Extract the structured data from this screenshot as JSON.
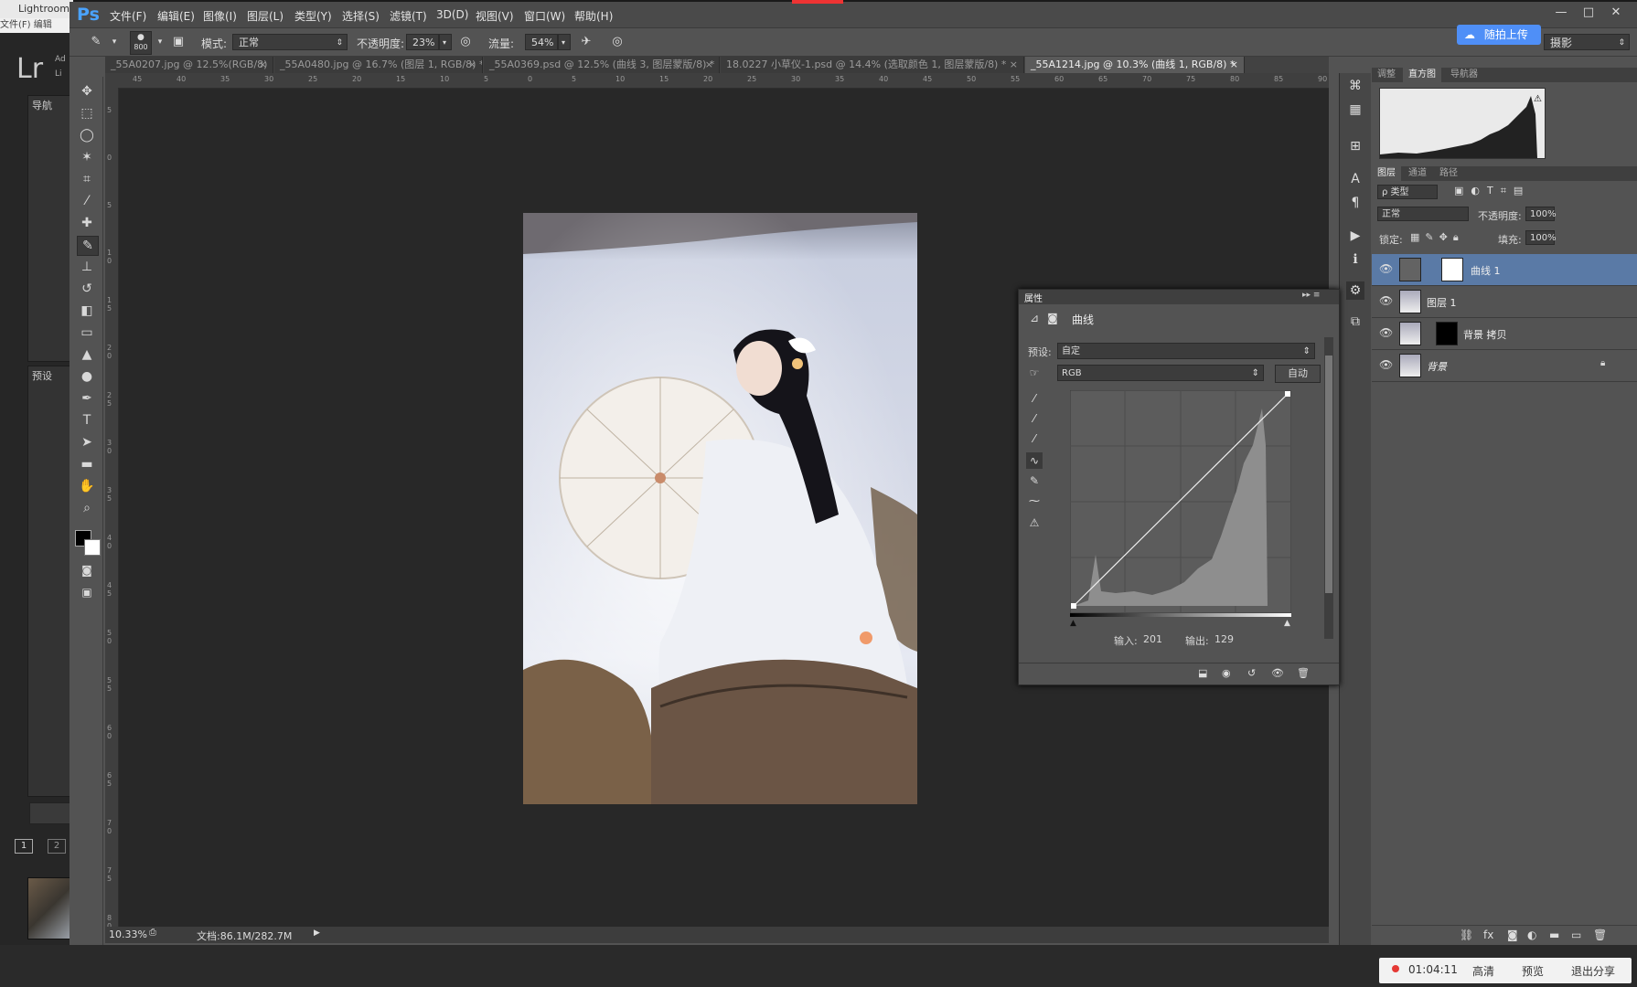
{
  "lightroom": {
    "tab_title": "Lightroom",
    "menu_text": "文件(F)  编辑",
    "logo": "Lr",
    "sub_logo_a": "Ad",
    "sub_logo_b": "Li",
    "nav_label": "导航",
    "preset_label": "预设",
    "page_1": "1",
    "page_2": "2"
  },
  "ps": {
    "logo": "Ps",
    "menus": [
      "文件(F)",
      "编辑(E)",
      "图像(I)",
      "图层(L)",
      "类型(Y)",
      "选择(S)",
      "滤镜(T)",
      "3D(D)",
      "视图(V)",
      "窗口(W)",
      "帮助(H)"
    ],
    "window_buttons": [
      "—",
      "□",
      "✕"
    ]
  },
  "options": {
    "brush_size": "800",
    "mode_label": "模式:",
    "mode_value": "正常",
    "opacity_label": "不透明度:",
    "opacity_value": "23%",
    "flow_label": "流量:",
    "flow_value": "54%",
    "upload_label": "随拍上传",
    "workspace": "摄影"
  },
  "tabs": [
    {
      "label": "_55A0207.jpg @ 12.5%(RGB/8)",
      "close": "×"
    },
    {
      "label": "_55A0480.jpg @ 16.7% (图层 1, RGB/8) *",
      "close": "×"
    },
    {
      "label": "_55A0369.psd @ 12.5% (曲线 3, 图层蒙版/8) *",
      "close": "×"
    },
    {
      "label": "18.0227 小草仪-1.psd @ 14.4% (选取颜色 1, 图层蒙版/8) *",
      "close": "×"
    },
    {
      "label": "_55A1214.jpg @ 10.3% (曲线 1, RGB/8) *",
      "close": "×"
    }
  ],
  "ruler_top": [
    "45",
    "40",
    "35",
    "30",
    "25",
    "20",
    "15",
    "10",
    "5",
    "0",
    "5",
    "10",
    "15",
    "20",
    "25",
    "30",
    "35",
    "40",
    "45",
    "50",
    "55",
    "60",
    "65",
    "70",
    "75",
    "80",
    "85",
    "90"
  ],
  "ruler_left": [
    "5",
    "0",
    "5",
    "1 0",
    "1 5",
    "2 0",
    "2 5",
    "3 0",
    "3 5",
    "4 0",
    "4 5",
    "5 0",
    "5 5",
    "6 0",
    "6 5",
    "7 0",
    "7 5",
    "8 0"
  ],
  "status": {
    "zoom": "10.33%",
    "doc": "文档:86.1M/282.7M"
  },
  "histogram_panel": {
    "tabs": [
      "调整",
      "直方图",
      "导航器"
    ]
  },
  "layers_panel": {
    "tabs": [
      "图层",
      "通道",
      "路径"
    ],
    "filter": "ρ 类型",
    "blend": "正常",
    "opacity_label": "不透明度:",
    "opacity_value": "100%",
    "lock_label": "锁定:",
    "fill_label": "填充:",
    "fill_value": "100%",
    "layers": [
      {
        "name": "曲线 1",
        "selected": true
      },
      {
        "name": "图层 1",
        "selected": false
      },
      {
        "name": "背景 拷贝",
        "selected": false
      },
      {
        "name": "背景",
        "selected": false
      }
    ],
    "bottom_icons": [
      "link-icon",
      "fx-icon",
      "mask-icon",
      "adjustment-icon",
      "folder-icon",
      "new-layer-icon",
      "trash-icon"
    ]
  },
  "properties": {
    "title": "属性",
    "panel_name": "曲线",
    "preset_label": "预设:",
    "preset_value": "自定",
    "channel_value": "RGB",
    "auto_label": "自动",
    "input_label": "输入:",
    "input_value": "201",
    "output_label": "输出:",
    "output_value": "129"
  },
  "recording": {
    "time": "01:04:11",
    "quality": "高清",
    "preview": "预览",
    "exit": "退出分享"
  },
  "accent_colors": {
    "selection": "#5a7aa6",
    "upload": "#4f8ff7",
    "record": "#e53935"
  }
}
